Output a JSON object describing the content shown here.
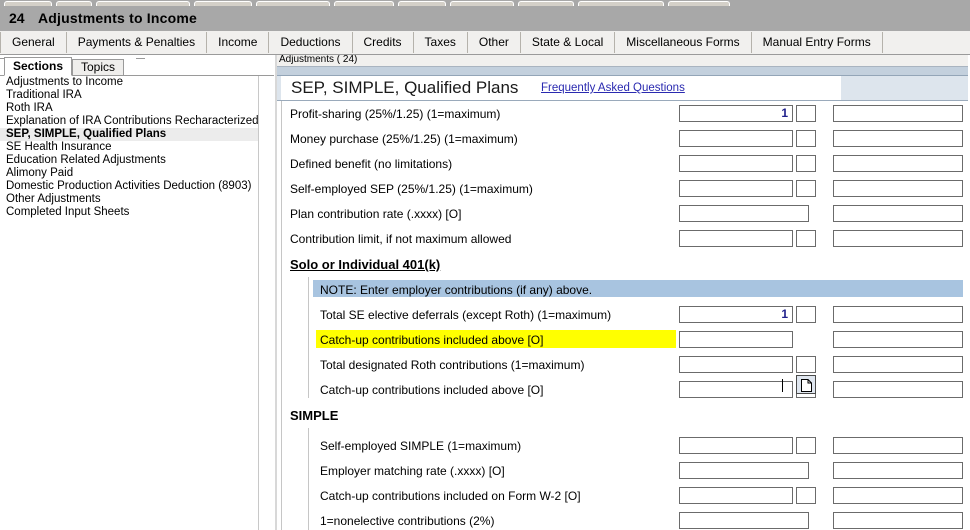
{
  "window": {
    "form_number": "24",
    "title": "Adjustments to Income"
  },
  "top_tabs": [
    {
      "label": "General"
    },
    {
      "label": "Payments & Penalties"
    },
    {
      "label": "Income"
    },
    {
      "label": "Deductions"
    },
    {
      "label": "Credits"
    },
    {
      "label": "Taxes"
    },
    {
      "label": "Other"
    },
    {
      "label": "State & Local"
    },
    {
      "label": "Miscellaneous Forms"
    },
    {
      "label": "Manual Entry Forms"
    }
  ],
  "left_pane": {
    "tabs": [
      {
        "label": "Sections",
        "active": true
      },
      {
        "label": "Topics",
        "active": false
      }
    ],
    "items": [
      {
        "label": "Adjustments to Income",
        "selected": false
      },
      {
        "label": "Traditional IRA",
        "selected": false
      },
      {
        "label": "Roth IRA",
        "selected": false
      },
      {
        "label": "Explanation of IRA Contributions Recharacterized",
        "selected": false
      },
      {
        "label": "SEP, SIMPLE, Qualified Plans",
        "selected": true
      },
      {
        "label": "SE Health Insurance",
        "selected": false
      },
      {
        "label": "Education Related Adjustments",
        "selected": false
      },
      {
        "label": "Alimony Paid",
        "selected": false
      },
      {
        "label": "Domestic Production Activities Deduction (8903)",
        "selected": false
      },
      {
        "label": "Other Adjustments",
        "selected": false
      },
      {
        "label": "Completed Input Sheets",
        "selected": false
      }
    ]
  },
  "content": {
    "breadcrumb": "Adjustments  ( 24)",
    "section_title": "SEP, SIMPLE, Qualified Plans",
    "faq_link": "Frequently Asked Questions",
    "rows": [
      {
        "label": "Profit-sharing (25%/1.25) (1=maximum)",
        "value": "1",
        "has_small": true
      },
      {
        "label": "Money purchase (25%/1.25) (1=maximum)",
        "value": "",
        "has_small": true
      },
      {
        "label": "Defined benefit (no limitations)",
        "value": "",
        "has_small": true
      },
      {
        "label": "Self-employed SEP (25%/1.25) (1=maximum)",
        "value": "",
        "has_small": true
      },
      {
        "label": "Plan contribution rate (.xxxx) [O]",
        "value": "",
        "has_small": false
      },
      {
        "label": "Contribution limit, if not maximum allowed",
        "value": "",
        "has_small": true
      }
    ],
    "solo_heading": "Solo or Individual 401(k)",
    "solo_note": "NOTE: Enter employer contributions (if any) above.",
    "solo_rows": [
      {
        "label": "Total SE elective deferrals (except Roth) (1=maximum)",
        "value": "1",
        "has_small": true,
        "highlight": false
      },
      {
        "label": "Catch-up contributions included above [O]",
        "value": "",
        "has_small": true,
        "highlight": true
      },
      {
        "label": "Total designated Roth contributions (1=maximum)",
        "value": "",
        "has_small": true,
        "highlight": false
      },
      {
        "label": "Catch-up contributions included above [O]",
        "value": "",
        "has_small": true,
        "highlight": false
      }
    ],
    "simple_heading": "SIMPLE",
    "simple_rows": [
      {
        "label": "Self-employed SIMPLE (1=maximum)",
        "value": "",
        "has_small": true
      },
      {
        "label": "Employer matching rate (.xxxx) [O]",
        "value": "",
        "has_small": false
      },
      {
        "label": "Catch-up contributions included on Form W-2 [O]",
        "value": "",
        "has_small": true
      },
      {
        "label": "1=nonelective contributions (2%)",
        "value": "",
        "has_small": false
      }
    ]
  },
  "colors": {
    "titlebar": "#a8a8a8",
    "highlight": "#ffff00",
    "note": "#a8c4e0",
    "link": "#2a2ab0",
    "field_text": "#20208c"
  }
}
